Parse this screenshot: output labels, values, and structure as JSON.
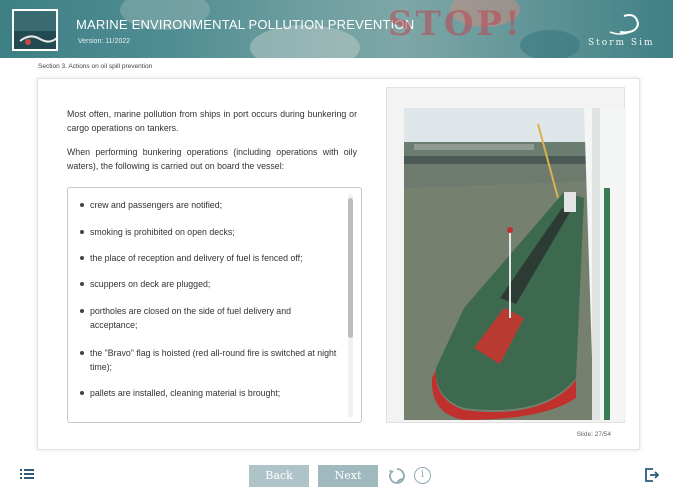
{
  "header": {
    "title": "MARINE ENVIRONMENTAL POLLUTION PREVENTION",
    "version": "Version: 11/2022",
    "stop_text": "STOP!",
    "brand": "Storm Sim"
  },
  "breadcrumb": "Section 3. Actions on oil spill prevention",
  "content": {
    "intro_1": "Most often, marine pollution from ships in port occurs during bunkering or cargo operations on tankers.",
    "intro_2": "When performing bunkering operations (including operations with oily waters), the following is carried out on board the vessel:",
    "items": [
      "crew and passengers are notified;",
      "smoking is prohibited on open decks;",
      "the place of reception and delivery of fuel is fenced off;",
      "scuppers on deck are plugged;",
      "portholes are closed on the side of fuel delivery and acceptance;",
      "the \"Bravo\" flag is hoisted (red all-round fire is switched at night time);",
      "pallets are installed, cleaning material is brought;"
    ]
  },
  "slide_counter": "Slide: 27/54",
  "nav": {
    "back_label": "Back",
    "next_label": "Next",
    "info_label": "i"
  },
  "icons": {
    "menu": "menu-list-icon",
    "reload": "reload-icon",
    "info": "info-icon",
    "exit": "exit-icon"
  },
  "colors": {
    "header_teal": "#4f8d92",
    "button_bg": "#aec4c9",
    "ship_hull_red": "#c0302d",
    "deck_green": "#3d6a4f"
  }
}
